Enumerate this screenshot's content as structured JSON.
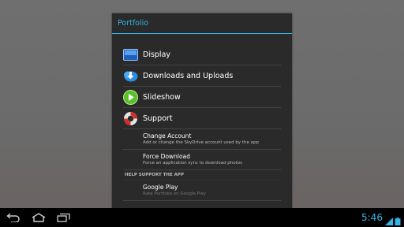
{
  "dialog": {
    "title": "Portfolio",
    "items": [
      {
        "label": "Display",
        "icon": "display-icon"
      },
      {
        "label": "Downloads and Uploads",
        "icon": "download-icon"
      },
      {
        "label": "Slideshow",
        "icon": "play-icon"
      },
      {
        "label": "Support",
        "icon": "lifebuoy-icon"
      }
    ],
    "change_account": {
      "title": "Change Account",
      "desc": "Add or change the SkyDrive account used by the app"
    },
    "force_download": {
      "title": "Force Download",
      "desc": "Force an application sync to download photos"
    },
    "section_label": "HELP SUPPORT THE APP",
    "google_play": {
      "title": "Google Play",
      "desc": "Rate Portfolio on Google Play"
    }
  },
  "status": {
    "time": "5:46"
  },
  "colors": {
    "accent": "#33b5e5",
    "dialog_bg": "#2a2a2a"
  }
}
